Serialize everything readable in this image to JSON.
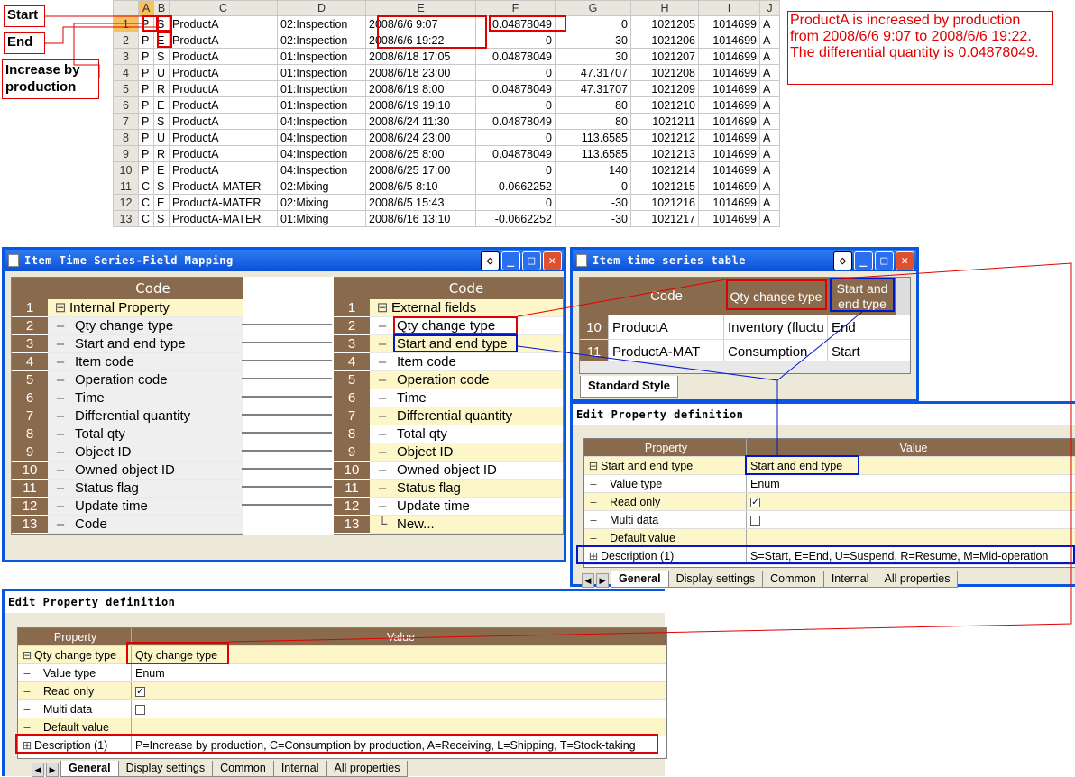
{
  "callouts": {
    "start": "Start",
    "end": "End",
    "increase": "Increase by production",
    "note": "ProductA is increased by production from 2008/6/6 9:07 to 2008/6/6 19:22. The differential quantity is 0.04878049."
  },
  "spreadsheet": {
    "columns": [
      "A",
      "B",
      "C",
      "D",
      "E",
      "F",
      "G",
      "H",
      "I",
      "J"
    ],
    "rows": [
      [
        "1",
        "P",
        "S",
        "ProductA",
        "02:Inspection",
        "2008/6/6 9:07",
        "0.04878049",
        "0",
        "1021205",
        "1014699",
        "A"
      ],
      [
        "2",
        "P",
        "E",
        "ProductA",
        "02:Inspection",
        "2008/6/6 19:22",
        "0",
        "30",
        "1021206",
        "1014699",
        "A"
      ],
      [
        "3",
        "P",
        "S",
        "ProductA",
        "01:Inspection",
        "2008/6/18 17:05",
        "0.04878049",
        "30",
        "1021207",
        "1014699",
        "A"
      ],
      [
        "4",
        "P",
        "U",
        "ProductA",
        "01:Inspection",
        "2008/6/18 23:00",
        "0",
        "47.31707",
        "1021208",
        "1014699",
        "A"
      ],
      [
        "5",
        "P",
        "R",
        "ProductA",
        "01:Inspection",
        "2008/6/19 8:00",
        "0.04878049",
        "47.31707",
        "1021209",
        "1014699",
        "A"
      ],
      [
        "6",
        "P",
        "E",
        "ProductA",
        "01:Inspection",
        "2008/6/19 19:10",
        "0",
        "80",
        "1021210",
        "1014699",
        "A"
      ],
      [
        "7",
        "P",
        "S",
        "ProductA",
        "04:Inspection",
        "2008/6/24 11:30",
        "0.04878049",
        "80",
        "1021211",
        "1014699",
        "A"
      ],
      [
        "8",
        "P",
        "U",
        "ProductA",
        "04:Inspection",
        "2008/6/24 23:00",
        "0",
        "113.6585",
        "1021212",
        "1014699",
        "A"
      ],
      [
        "9",
        "P",
        "R",
        "ProductA",
        "04:Inspection",
        "2008/6/25 8:00",
        "0.04878049",
        "113.6585",
        "1021213",
        "1014699",
        "A"
      ],
      [
        "10",
        "P",
        "E",
        "ProductA",
        "04:Inspection",
        "2008/6/25 17:00",
        "0",
        "140",
        "1021214",
        "1014699",
        "A"
      ],
      [
        "11",
        "C",
        "S",
        "ProductA-MATER",
        "02:Mixing",
        "2008/6/5 8:10",
        "-0.0662252",
        "0",
        "1021215",
        "1014699",
        "A"
      ],
      [
        "12",
        "C",
        "E",
        "ProductA-MATER",
        "02:Mixing",
        "2008/6/5 15:43",
        "0",
        "-30",
        "1021216",
        "1014699",
        "A"
      ],
      [
        "13",
        "C",
        "S",
        "ProductA-MATER",
        "01:Mixing",
        "2008/6/16 13:10",
        "-0.0662252",
        "-30",
        "1021217",
        "1014699",
        "A"
      ]
    ]
  },
  "mapping_window": {
    "title": "Item Time Series-Field Mapping",
    "left_header": "Code",
    "right_header": "Code",
    "left_items": [
      "Internal Property",
      "Qty change type",
      "Start and end type",
      "Item code",
      "Operation code",
      "Time",
      "Differential quantity",
      "Total qty",
      "Object ID",
      "Owned object ID",
      "Status flag",
      "Update time",
      "Code"
    ],
    "right_items": [
      "External fields",
      "Qty change type",
      "Start and end type",
      "Item code",
      "Operation code",
      "Time",
      "Differential quantity",
      "Total qty",
      "Object ID",
      "Owned object ID",
      "Status flag",
      "Update time",
      "New..."
    ],
    "row_numbers": [
      "1",
      "2",
      "3",
      "4",
      "5",
      "6",
      "7",
      "8",
      "9",
      "10",
      "11",
      "12",
      "13"
    ]
  },
  "series_window": {
    "title": "Item time series table",
    "headers": [
      "Code",
      "Qty change type",
      "Start and end type"
    ],
    "rows": [
      {
        "num": "10",
        "code": "ProductA",
        "qty": "Inventory (fluctu",
        "se": "End"
      },
      {
        "num": "11",
        "code": "ProductA-MAT",
        "qty": "Consumption",
        "se": "Start"
      }
    ],
    "tab": "Standard Style"
  },
  "prop_right": {
    "title": "Edit Property definition",
    "header_property": "Property",
    "header_value": "Value",
    "rows": [
      {
        "name": "Start and end type",
        "value": "Start and end type"
      },
      {
        "name": "Value type",
        "value": "Enum"
      },
      {
        "name": "Read only",
        "value": ""
      },
      {
        "name": "Multi data",
        "value": ""
      },
      {
        "name": "Default value",
        "value": ""
      },
      {
        "name": "Description (1)",
        "value": "S=Start, E=End, U=Suspend, R=Resume, M=Mid-operation"
      }
    ],
    "tabs": [
      "General",
      "Display settings",
      "Common",
      "Internal",
      "All properties"
    ]
  },
  "prop_bottom": {
    "title": "Edit Property definition",
    "header_property": "Property",
    "header_value": "Value",
    "rows": [
      {
        "name": "Qty change type",
        "value": "Qty change type"
      },
      {
        "name": "Value type",
        "value": "Enum"
      },
      {
        "name": "Read only",
        "value": ""
      },
      {
        "name": "Multi data",
        "value": ""
      },
      {
        "name": "Default value",
        "value": ""
      },
      {
        "name": "Description (1)",
        "value": "P=Increase by production, C=Consumption by production, A=Receiving, L=Shipping, T=Stock-taking"
      }
    ],
    "tabs": [
      "General",
      "Display settings",
      "Common",
      "Internal",
      "All properties"
    ]
  },
  "colors": {
    "accent_red": "#e00000",
    "accent_blue": "#0018c8",
    "title_blue": "#0a56e0",
    "grid_header": "#8a6a4d",
    "row_yellow": "#fcf6c8"
  }
}
